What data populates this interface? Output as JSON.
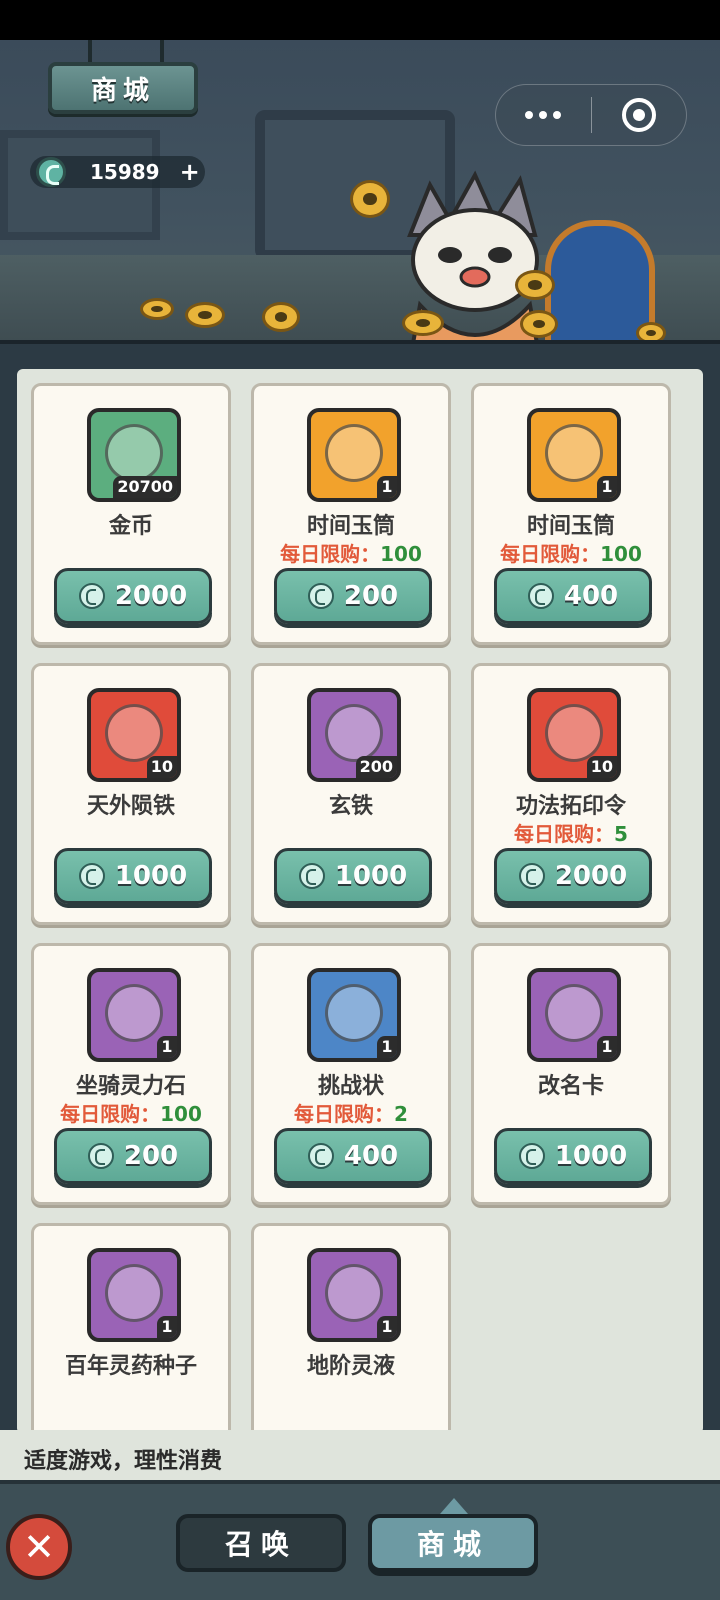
{
  "header": {
    "title": "商城",
    "currency": {
      "icon": "jade-currency-icon",
      "amount": "15989",
      "add_label": "+"
    }
  },
  "capsule": {
    "more_icon": "more-dots-icon",
    "close_icon": "target-close-icon"
  },
  "items": [
    {
      "name": "金币",
      "qty": "20700",
      "limit_label": "",
      "limit_value": "",
      "price": "2000",
      "icon": "gold-coin-icon",
      "color": "#5cae7f"
    },
    {
      "name": "时间玉筒",
      "qty": "1",
      "limit_label": "每日限购：",
      "limit_value": "100",
      "price": "200",
      "icon": "jade-hourglass-icon",
      "color": "#f2a22c"
    },
    {
      "name": "时间玉筒",
      "qty": "1",
      "limit_label": "每日限购：",
      "limit_value": "100",
      "price": "400",
      "icon": "jade-hourglass-icon",
      "color": "#f2a22c"
    },
    {
      "name": "天外陨铁",
      "qty": "10",
      "limit_label": "",
      "limit_value": "",
      "price": "1000",
      "icon": "meteorite-icon",
      "color": "#e04b3a"
    },
    {
      "name": "玄铁",
      "qty": "200",
      "limit_label": "",
      "limit_value": "",
      "price": "1000",
      "icon": "iron-ingot-icon",
      "color": "#9a63b6"
    },
    {
      "name": "功法拓印令",
      "qty": "10",
      "limit_label": "每日限购：",
      "limit_value": "5",
      "price": "2000",
      "icon": "technique-token-icon",
      "color": "#e04b3a"
    },
    {
      "name": "坐骑灵力石",
      "qty": "1",
      "limit_label": "每日限购：",
      "limit_value": "100",
      "price": "200",
      "icon": "spirit-stone-icon",
      "color": "#9a63b6"
    },
    {
      "name": "挑战状",
      "qty": "1",
      "limit_label": "每日限购：",
      "limit_value": "2",
      "price": "400",
      "icon": "challenge-letter-icon",
      "color": "#4d86c7"
    },
    {
      "name": "改名卡",
      "qty": "1",
      "limit_label": "",
      "limit_value": "",
      "price": "1000",
      "icon": "rename-card-icon",
      "color": "#9a63b6"
    },
    {
      "name": "百年灵药种子",
      "qty": "1",
      "limit_label": "",
      "limit_value": "",
      "price": "",
      "icon": "herb-seed-icon",
      "color": "#9a63b6"
    },
    {
      "name": "地阶灵液",
      "qty": "1",
      "limit_label": "",
      "limit_value": "",
      "price": "",
      "icon": "elixir-bottle-icon",
      "color": "#9a63b6"
    }
  ],
  "notice": "适度游戏，理性消费",
  "nav": {
    "close_label": "✕",
    "summon_label": "召唤",
    "shop_label": "商城"
  }
}
